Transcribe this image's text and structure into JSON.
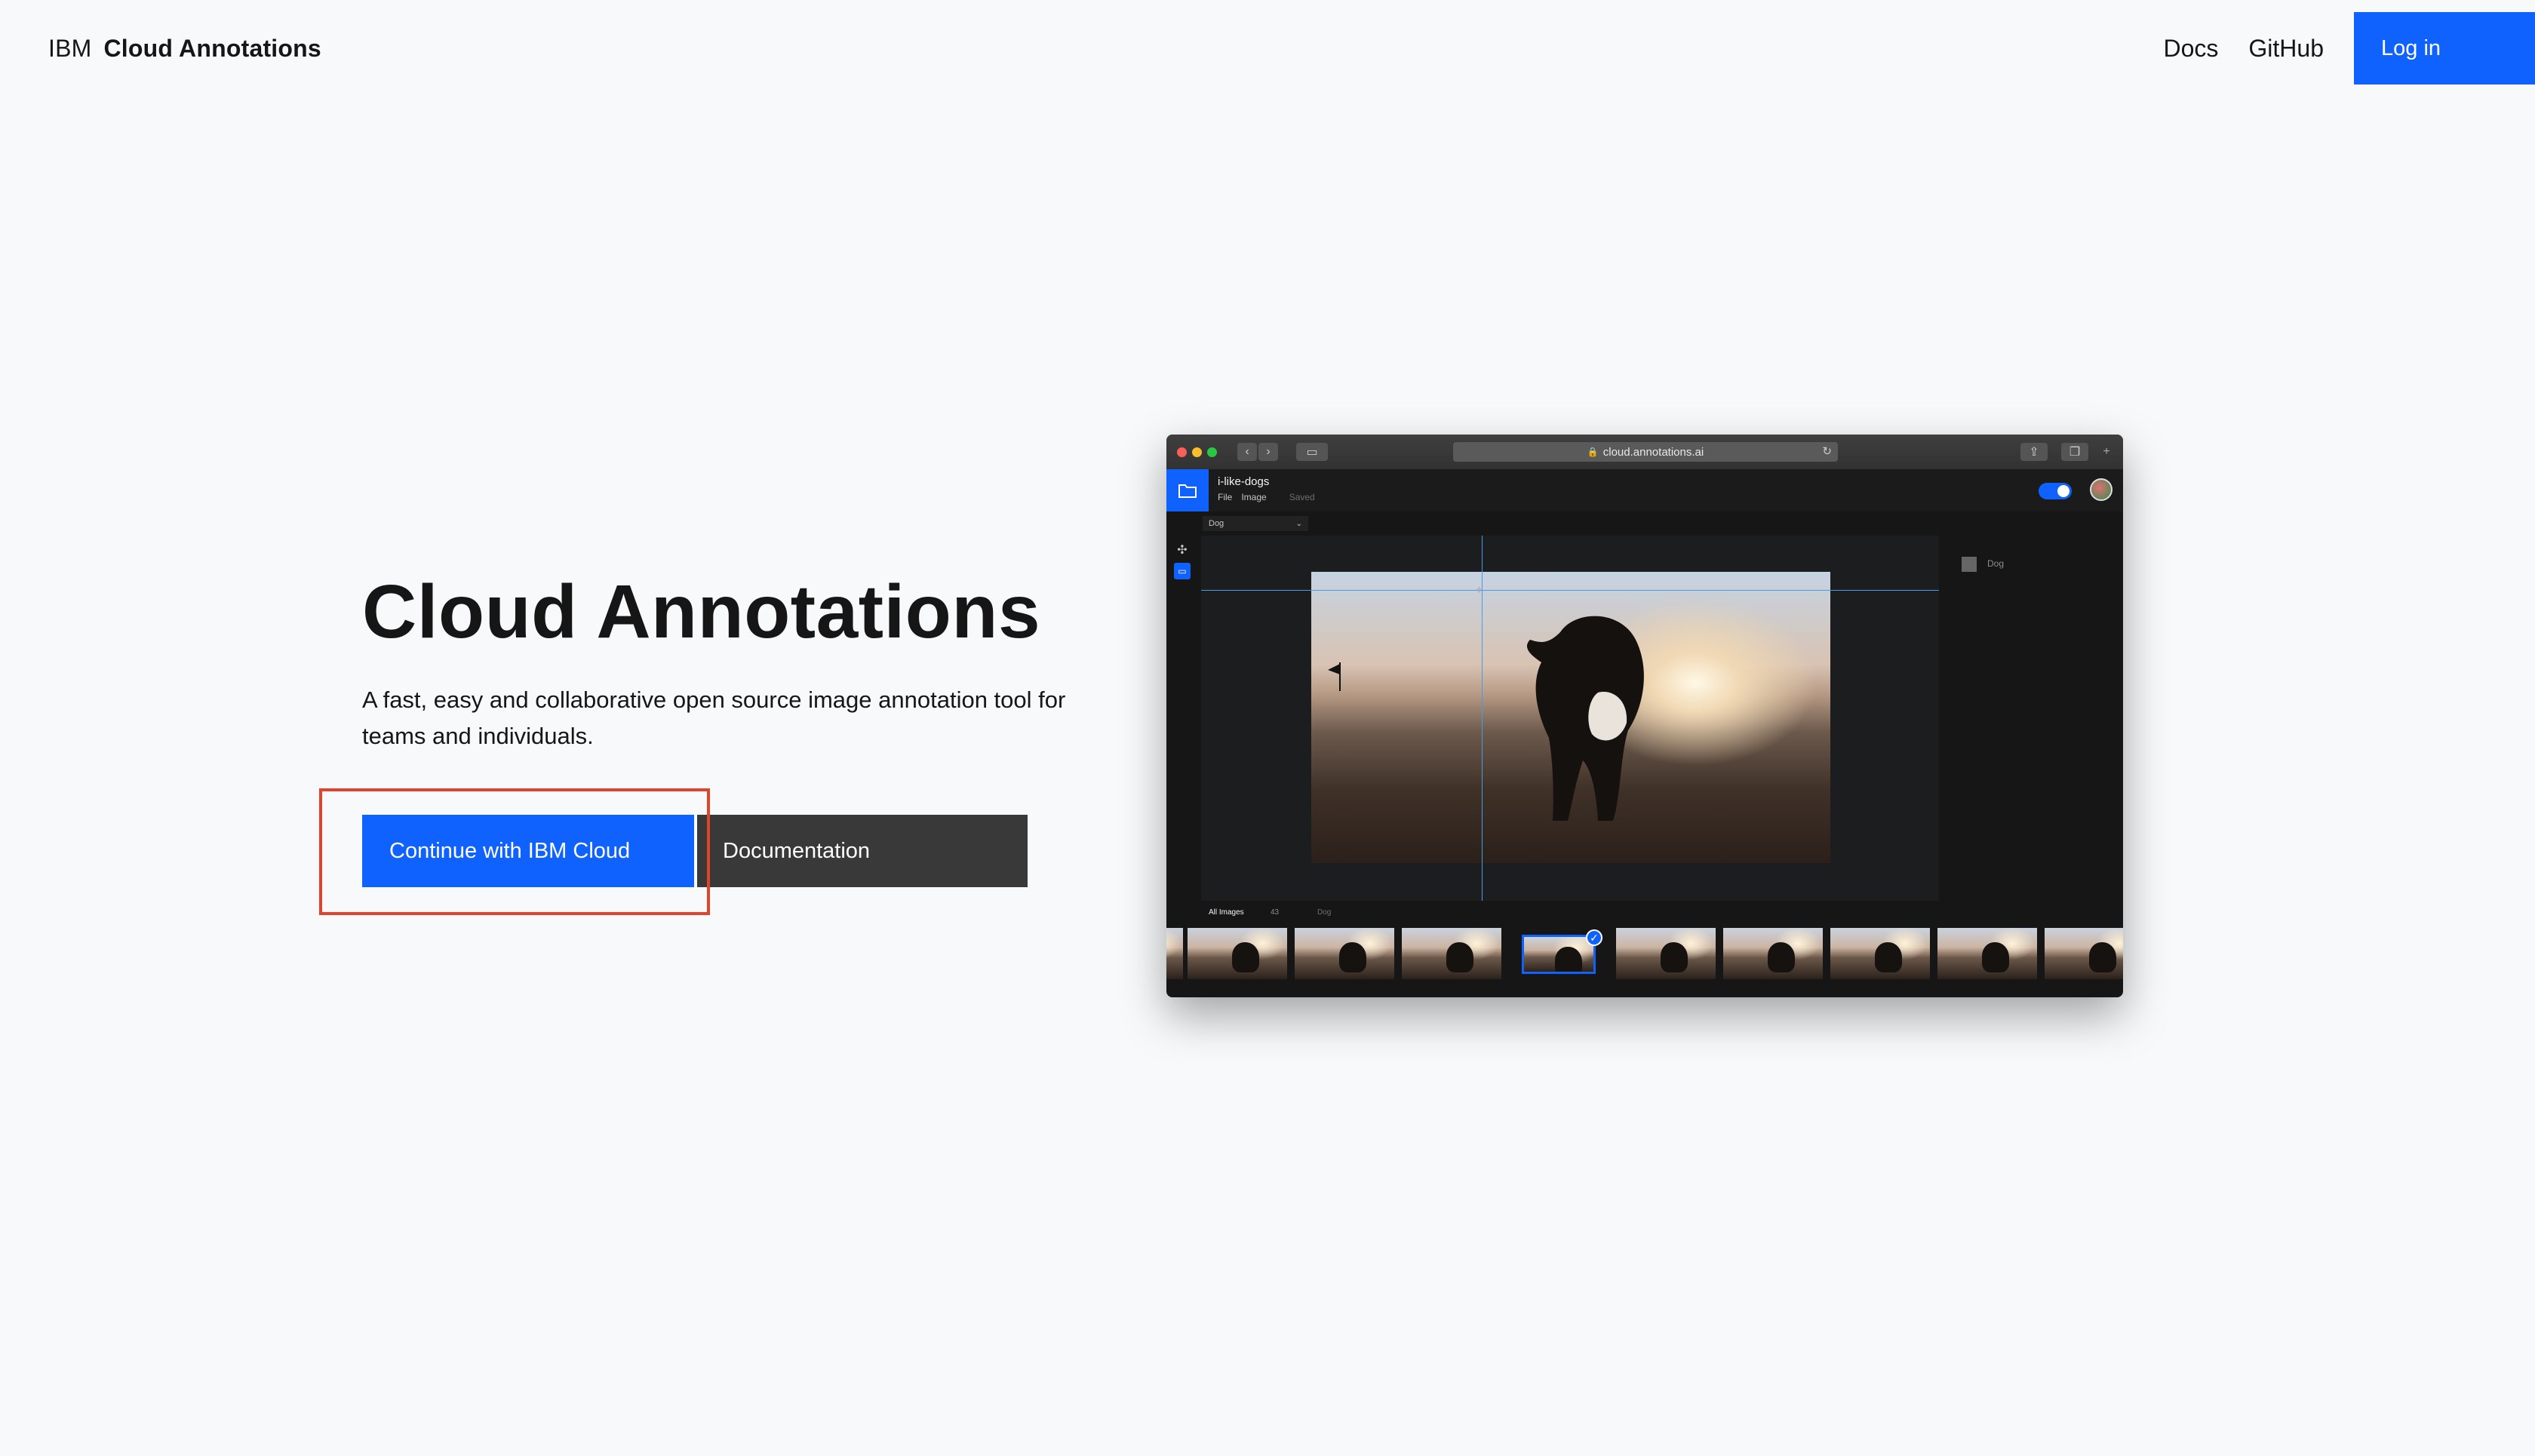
{
  "header": {
    "brand_prefix": "IBM",
    "brand_product": "Cloud Annotations",
    "nav": [
      {
        "label": "Docs"
      },
      {
        "label": "GitHub"
      }
    ],
    "login_label": "Log in",
    "accent_color": "#0f62fe"
  },
  "hero": {
    "title": "Cloud Annotations",
    "description": "A fast, easy and collaborative open source image annotation tool for teams and individuals.",
    "primary_cta": "Continue with IBM Cloud",
    "secondary_cta": "Documentation",
    "highlight_color": "#e0442a"
  },
  "preview": {
    "url": "cloud.annotations.ai",
    "project_name": "i-like-dogs",
    "menu": [
      "File",
      "Image"
    ],
    "save_status": "Saved",
    "active_label": "Dog",
    "panel_label": "Dog",
    "filter_all": "All Images",
    "filter_count": "43",
    "filter_label": "Dog"
  }
}
